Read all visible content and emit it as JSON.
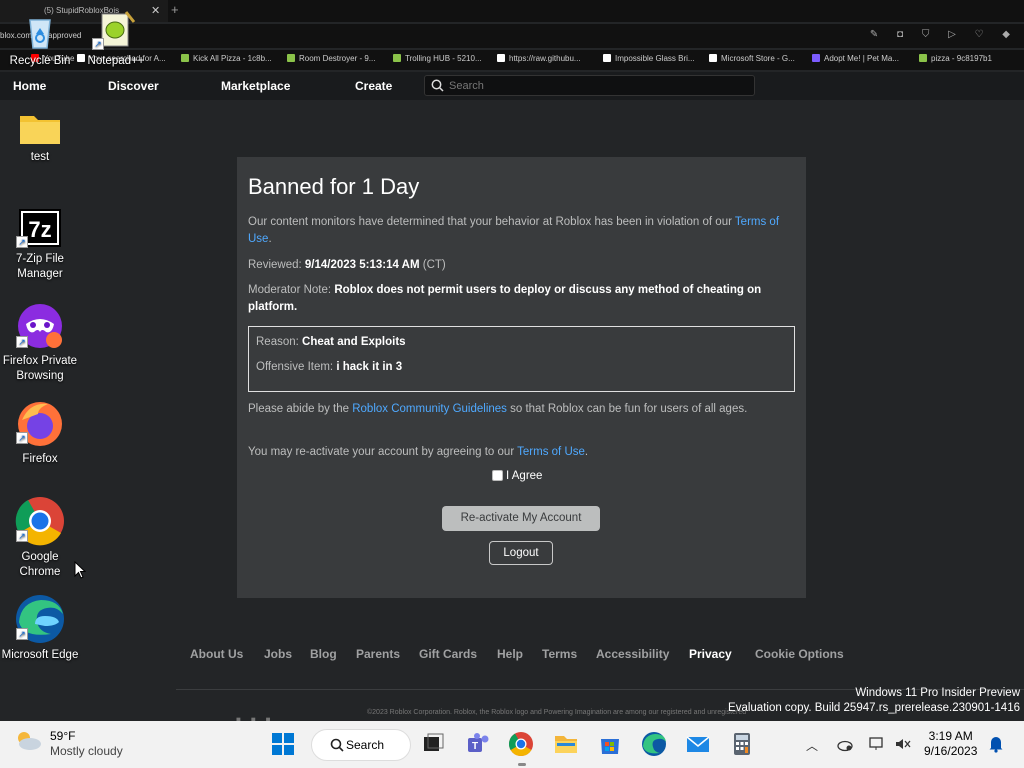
{
  "browser": {
    "tab_title": "(5) StupidRobloxBois",
    "url": "blox.com/not-approved",
    "bookmarks": [
      {
        "label": "YouTube",
        "color": "#ff0000"
      },
      {
        "label": "Your searched for A...",
        "color": "#ffffff"
      },
      {
        "label": "Kick All Pizza - 1c8b...",
        "color": "#8bc34a"
      },
      {
        "label": "Room Destroyer - 9...",
        "color": "#8bc34a"
      },
      {
        "label": "Trolling HUB - 5210...",
        "color": "#8bc34a"
      },
      {
        "label": "https://raw.githubu...",
        "color": "#ffffff"
      },
      {
        "label": "Impossible Glass Bri...",
        "color": "#ffffff"
      },
      {
        "label": "Microsoft Store - G...",
        "color": "#ffffff"
      },
      {
        "label": "Adopt Me! | Pet Ma...",
        "color": "#7c5cff"
      },
      {
        "label": "pizza - 9c8197b1",
        "color": "#8bc34a"
      }
    ]
  },
  "nav": {
    "home": "Home",
    "discover": "Discover",
    "marketplace": "Marketplace",
    "create": "Create",
    "search_placeholder": "Search"
  },
  "ban": {
    "title": "Banned for 1 Day",
    "intro": "Our content monitors have determined that your behavior at Roblox has been in violation of our",
    "terms_link": "Terms of Use",
    "reviewed_label": "Reviewed:",
    "reviewed_value": "9/14/2023 5:13:14 AM",
    "reviewed_tz": "(CT)",
    "mod_note_label": "Moderator Note:",
    "mod_note_value": "Roblox does not permit users to deploy or discuss any method of cheating on platform.",
    "reason_label": "Reason:",
    "reason_value": "Cheat and Exploits",
    "offensive_label": "Offensive Item:",
    "offensive_value": "i hack it in 3",
    "abide_pre": "Please abide by the",
    "guidelines_link": "Roblox Community Guidelines",
    "abide_post": "so that Roblox can be fun for users of all ages.",
    "reactivate_text": "You may re-activate your account by agreeing to our",
    "agree_label": "I Agree",
    "reactivate_button": "Re-activate My Account",
    "logout_button": "Logout"
  },
  "footer": {
    "links": [
      "About Us",
      "Jobs",
      "Blog",
      "Parents",
      "Gift Cards",
      "Help",
      "Terms",
      "Accessibility",
      "Privacy",
      "Cookie Options"
    ],
    "copyright": "©2023 Roblox Corporation. Roblox, the Roblox logo and Powering Imagination are among our registered and unregistered"
  },
  "watermark": {
    "line1": "Windows 11 Pro Insider Preview",
    "line2": "Evaluation copy. Build 25947.rs_prerelease.230901-1416"
  },
  "desktop": {
    "icons": [
      {
        "label": "Recycle Bin",
        "icon": "recycle-bin-icon"
      },
      {
        "label": "Notepad++",
        "icon": "notepad-plus-plus-icon"
      },
      {
        "label": "test",
        "icon": "folder-icon"
      },
      {
        "label": "7-Zip File Manager",
        "icon": "7zip-icon"
      },
      {
        "label": "Firefox Private Browsing",
        "icon": "firefox-private-icon"
      },
      {
        "label": "Firefox",
        "icon": "firefox-icon"
      },
      {
        "label": "Google Chrome",
        "icon": "chrome-icon"
      },
      {
        "label": "Microsoft Edge",
        "icon": "edge-icon"
      }
    ]
  },
  "taskbar": {
    "temperature": "59°F",
    "condition": "Mostly cloudy",
    "search_label": "Search",
    "time": "3:19 AM",
    "date": "9/16/2023"
  }
}
